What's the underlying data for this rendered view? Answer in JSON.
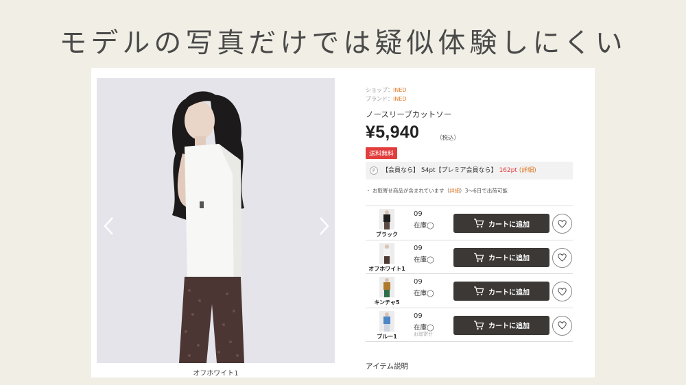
{
  "slide": {
    "title": "モデルの写真だけでは疑似体験しにくい"
  },
  "product": {
    "photo_caption": "オフホワイト1",
    "shop_label": "ショップ：",
    "shop_value": "INED",
    "brand_label": "ブランド：",
    "brand_value": "INED",
    "name": "ノースリーブカットソー",
    "price": "¥5,940",
    "tax": "（税込）",
    "shipping_badge": "送料無料",
    "points_icon": "P",
    "points_text_1": "【会員なら】 54pt【プレミア会員なら】",
    "points_premium": "162pt",
    "points_detail": "(詳細)",
    "note_text_1": "・ お取寄せ商品が含まれています（",
    "note_detail": "詳細",
    "note_text_2": "）3〜6日で出荷可能",
    "description_heading": "アイテム説明"
  },
  "variants": [
    {
      "name": "ブラック",
      "size": "09",
      "stock": "在庫◯",
      "order_note": "",
      "cart_label": "カートに追加",
      "top_color": "#1e1e1e",
      "bottom_color": "#5a4a44"
    },
    {
      "name": "オフホワイト1",
      "size": "09",
      "stock": "在庫◯",
      "order_note": "",
      "cart_label": "カートに追加",
      "top_color": "#f4f4f4",
      "bottom_color": "#4d3a34"
    },
    {
      "name": "キンチャ5",
      "size": "09",
      "stock": "在庫◯",
      "order_note": "",
      "cart_label": "カートに追加",
      "top_color": "#b07a2c",
      "bottom_color": "#2f6e4a"
    },
    {
      "name": "ブルー1",
      "size": "09",
      "stock": "在庫◯",
      "order_note": "お取寄せ",
      "cart_label": "カートに追加",
      "top_color": "#4f86c6",
      "bottom_color": "#cfd6e0"
    }
  ],
  "icons": {
    "prev": "chevron-left-icon",
    "next": "chevron-right-icon",
    "cart": "cart-icon",
    "favorite": "heart-icon"
  },
  "colors": {
    "accent_orange": "#e07b2a",
    "sale_red": "#e23c3c",
    "button_dark": "#3c3836"
  }
}
